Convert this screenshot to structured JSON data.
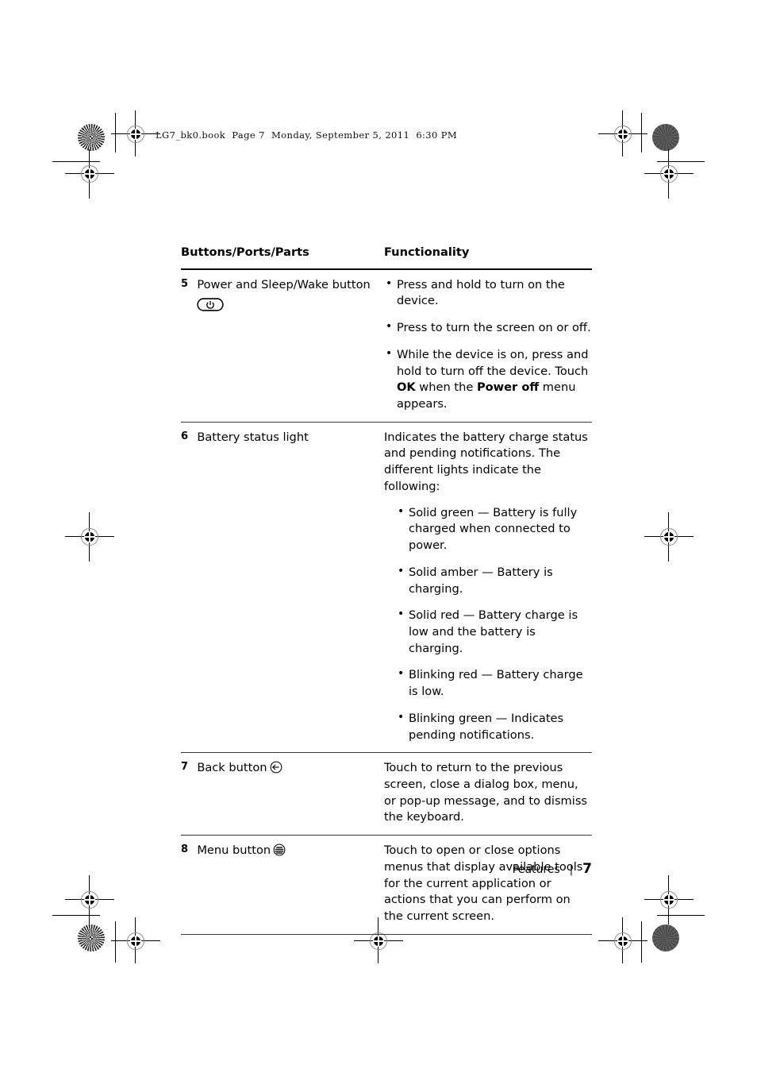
{
  "running_header": "LG7_bk0.book  Page 7  Monday, September 5, 2011  6:30 PM",
  "table": {
    "headers": {
      "col_name": "Buttons/Ports/Parts",
      "col_function": "Functionality"
    },
    "rows": [
      {
        "num": "5",
        "name": "Power and Sleep/Wake button",
        "icon": "power-button-icon",
        "func_type": "bullets",
        "bullets": [
          {
            "parts": [
              {
                "text": "Press and hold to turn on the device.",
                "bold": false
              }
            ]
          },
          {
            "parts": [
              {
                "text": "Press to turn the screen on or off.",
                "bold": false
              }
            ]
          },
          {
            "parts": [
              {
                "text": "While the device is on, press and hold to turn off the device. Touch ",
                "bold": false
              },
              {
                "text": "OK",
                "bold": true
              },
              {
                "text": " when the ",
                "bold": false
              },
              {
                "text": "Power off",
                "bold": true
              },
              {
                "text": " menu appears.",
                "bold": false
              }
            ]
          }
        ]
      },
      {
        "num": "6",
        "name": "Battery status light",
        "icon": null,
        "func_type": "lead_bullets",
        "lead": "Indicates the battery charge status and pending notifications. The different lights indicate the following:",
        "bullets": [
          {
            "parts": [
              {
                "text": "Solid green — Battery is fully charged when connected to power.",
                "bold": false
              }
            ]
          },
          {
            "parts": [
              {
                "text": "Solid amber — Battery is charging.",
                "bold": false
              }
            ]
          },
          {
            "parts": [
              {
                "text": "Solid red — Battery charge is low and the battery is charging.",
                "bold": false
              }
            ]
          },
          {
            "parts": [
              {
                "text": "Blinking red — Battery charge is low.",
                "bold": false
              }
            ]
          },
          {
            "parts": [
              {
                "text": "Blinking green — Indicates pending notifications.",
                "bold": false
              }
            ]
          }
        ]
      },
      {
        "num": "7",
        "name": "Back button",
        "icon": "back-button-icon",
        "icon_inline": true,
        "func_type": "paragraph",
        "paragraph": "Touch to return to the previous screen, close a dialog box, menu, or pop-up message, and to dismiss the keyboard."
      },
      {
        "num": "8",
        "name": "Menu button",
        "icon": "menu-button-icon",
        "icon_inline": true,
        "func_type": "paragraph",
        "paragraph": "Touch to open or close options menus that display available tools for the current application or actions that you can perform on the current screen."
      }
    ]
  },
  "footer": {
    "section": "Features",
    "separator": "|",
    "page_number": "7"
  }
}
